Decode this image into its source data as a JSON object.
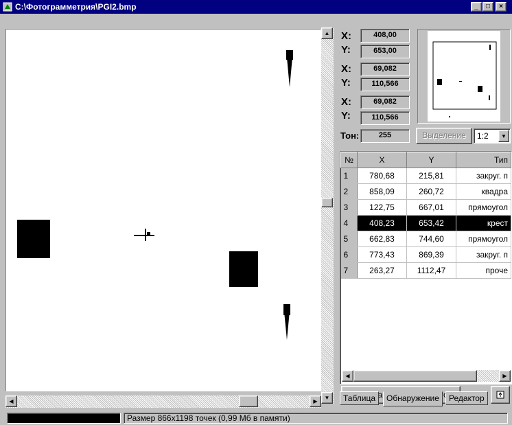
{
  "window": {
    "title": "C:\\Фотограмметрия\\PGI2.bmp",
    "minimize": "_",
    "maximize": "□",
    "close": "×"
  },
  "coords": [
    {
      "x_label": "X:",
      "x_value": "408,00",
      "y_label": "Y:",
      "y_value": "653,00"
    },
    {
      "x_label": "X:",
      "x_value": "69,082",
      "y_label": "Y:",
      "y_value": "110,566"
    },
    {
      "x_label": "X:",
      "x_value": "69,082",
      "y_label": "Y:",
      "y_value": "110,566"
    }
  ],
  "tone": {
    "label": "Тон:",
    "value": "255"
  },
  "selection_button": "Выделение",
  "zoom": {
    "value": "1:2"
  },
  "table": {
    "headers": [
      "№",
      "X",
      "Y",
      "Тип"
    ],
    "rows": [
      [
        "1",
        "780,68",
        "215,81",
        "закруг. п"
      ],
      [
        "2",
        "858,09",
        "260,72",
        "квадра"
      ],
      [
        "3",
        "122,75",
        "667,01",
        "прямоугол"
      ],
      [
        "4",
        "408,23",
        "653,42",
        "крест"
      ],
      [
        "5",
        "662,83",
        "744,60",
        "прямоугол"
      ],
      [
        "6",
        "773,43",
        "869,39",
        "закруг. п"
      ],
      [
        "7",
        "263,27",
        "1112,47",
        "проче"
      ]
    ],
    "selected_row": 3
  },
  "detect_button": {
    "icon_text": "?{}",
    "label": "Обнаружение объектов"
  },
  "tabs": [
    "Таблица",
    "Обнаружение",
    "Редактор"
  ],
  "active_tab": 1,
  "status": {
    "text": "Размер 866x1198 точек (0,99 Мб в памяти)"
  }
}
